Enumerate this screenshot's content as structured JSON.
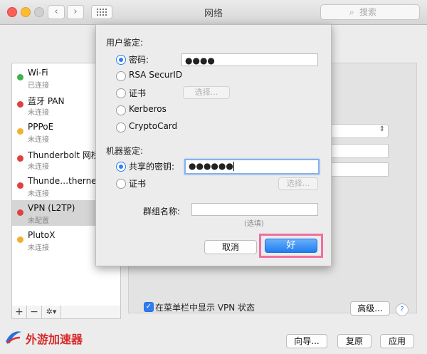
{
  "window": {
    "title": "网络",
    "search_placeholder": "搜索"
  },
  "sidebar": {
    "items": [
      {
        "name": "Wi-Fi",
        "status": "已连接",
        "color": "#3cb44b"
      },
      {
        "name": "蓝牙 PAN",
        "status": "未连接",
        "color": "#e04040"
      },
      {
        "name": "PPPoE",
        "status": "未连接",
        "color": "#f0b030"
      },
      {
        "name": "Thunderbolt 网桥",
        "status": "未连接",
        "color": "#e04040"
      },
      {
        "name": "Thunde…thernet",
        "status": "未连接",
        "color": "#e04040"
      },
      {
        "name": "VPN (L2TP)",
        "status": "未配置",
        "color": "#e04040"
      },
      {
        "name": "PlutoX",
        "status": "未连接",
        "color": "#f0b030"
      }
    ],
    "add_label": "+",
    "remove_label": "−",
    "gear_label": "✲▾"
  },
  "sheet": {
    "user_auth_label": "用户鉴定:",
    "user_auth_options": [
      "密码:",
      "RSA SecurID",
      "证书",
      "Kerberos",
      "CryptoCard"
    ],
    "password_value": "●●●●",
    "cert_select_label": "选择...",
    "machine_auth_label": "机器鉴定:",
    "machine_auth_options": [
      "共享的密钥:",
      "证书"
    ],
    "shared_secret_value": "●●●●●●",
    "machine_cert_select_label": "选择...",
    "group_name_label": "群组名称:",
    "group_name_value": "",
    "optional_hint": "(选填)",
    "cancel_label": "取消",
    "ok_label": "好"
  },
  "main": {
    "show_vpn_status_label": "在菜单栏中显示 VPN 状态",
    "advanced_label": "高级...",
    "help_label": "?",
    "assist_label": "向导...",
    "revert_label": "复原",
    "apply_label": "应用"
  },
  "watermark": {
    "text": "外游加速器"
  },
  "colors": {
    "accent": "#2f7df0",
    "highlight": "#f06fa0"
  }
}
